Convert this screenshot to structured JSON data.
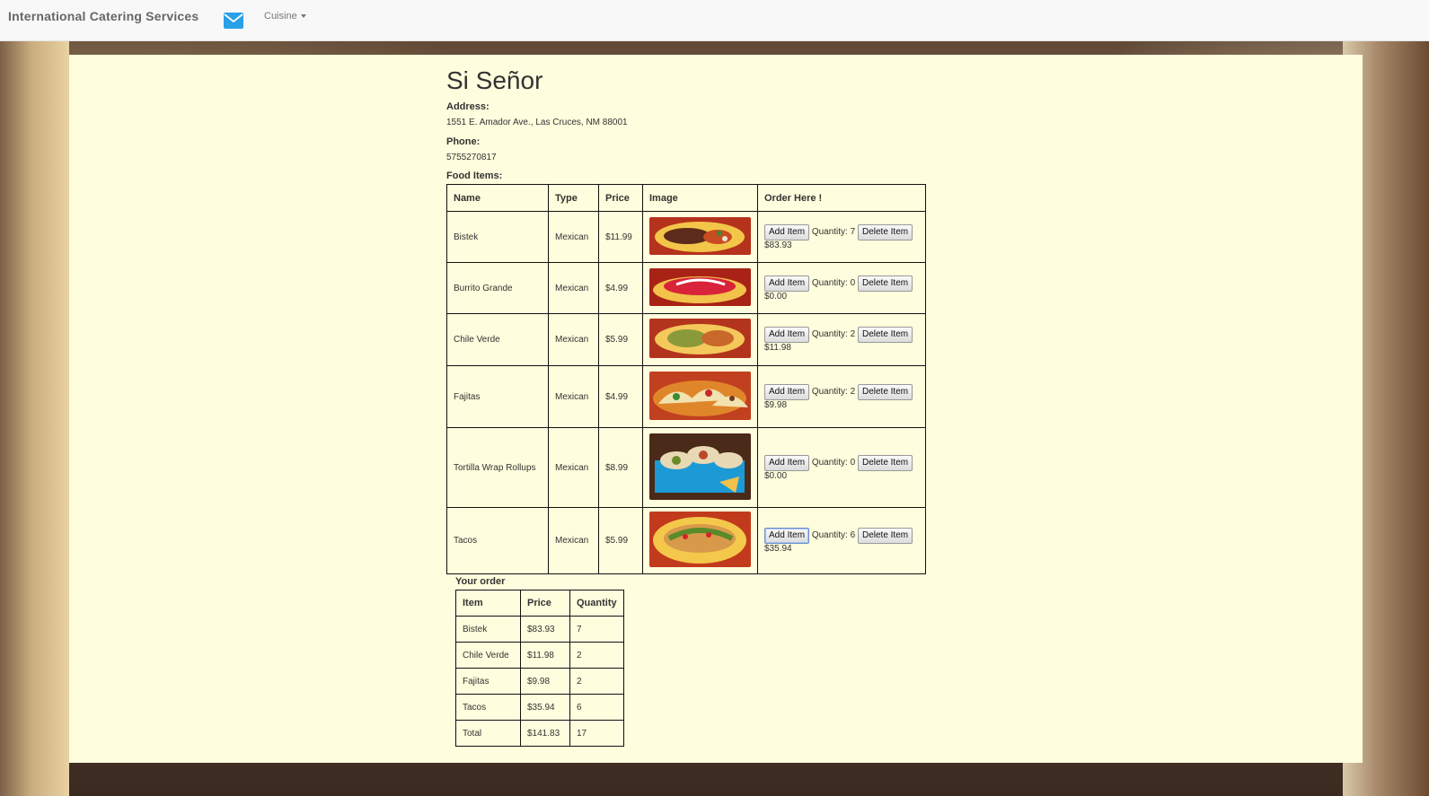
{
  "navbar": {
    "brand": "International Catering Services",
    "mail_icon": "envelope-icon",
    "cuisine_label": "Cuisine"
  },
  "restaurant": {
    "name": "Si Señor",
    "address_label": "Address:",
    "address": "1551 E. Amador Ave., Las Cruces, NM 88001",
    "phone_label": "Phone:",
    "phone": "5755270817",
    "food_label": "Food Items:"
  },
  "food_table": {
    "headers": [
      "Name",
      "Type",
      "Price",
      "Image",
      "Order Here !"
    ],
    "add_label": "Add Item",
    "delete_label": "Delete Item",
    "quantity_prefix": "Quantity:",
    "rows": [
      {
        "name": "Bistek",
        "type": "Mexican",
        "price": "$11.99",
        "quantity": "7",
        "subtotal": "$83.93"
      },
      {
        "name": "Burrito Grande",
        "type": "Mexican",
        "price": "$4.99",
        "quantity": "0",
        "subtotal": "$0.00"
      },
      {
        "name": "Chile Verde",
        "type": "Mexican",
        "price": "$5.99",
        "quantity": "2",
        "subtotal": "$11.98"
      },
      {
        "name": "Fajitas",
        "type": "Mexican",
        "price": "$4.99",
        "quantity": "2",
        "subtotal": "$9.98"
      },
      {
        "name": "Tortilla Wrap Rollups",
        "type": "Mexican",
        "price": "$8.99",
        "quantity": "0",
        "subtotal": "$0.00"
      },
      {
        "name": "Tacos",
        "type": "Mexican",
        "price": "$5.99",
        "quantity": "6",
        "subtotal": "$35.94"
      }
    ]
  },
  "your_order": {
    "title": "Your order",
    "headers": [
      "Item",
      "Price",
      "Quantity"
    ],
    "rows": [
      {
        "item": "Bistek",
        "price": "$83.93",
        "quantity": "7"
      },
      {
        "item": "Chile Verde",
        "price": "$11.98",
        "quantity": "2"
      },
      {
        "item": "Fajitas",
        "price": "$9.98",
        "quantity": "2"
      },
      {
        "item": "Tacos",
        "price": "$35.94",
        "quantity": "6"
      },
      {
        "item": "Total",
        "price": "$141.83",
        "quantity": "17"
      }
    ]
  },
  "colors": {
    "panel_bg": "#fefddd",
    "navbar_bg": "#f8f8f8",
    "mail_icon": "#2aa0e6"
  }
}
